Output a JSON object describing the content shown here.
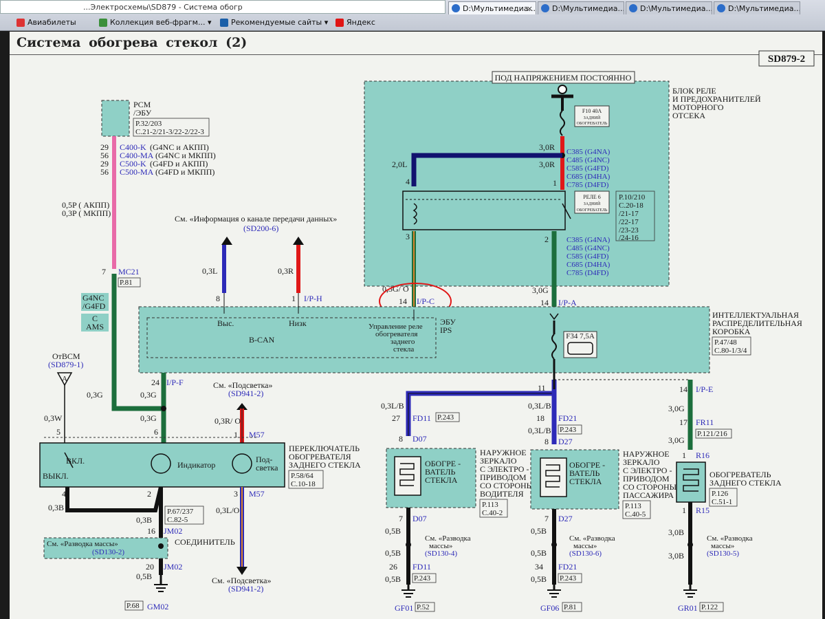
{
  "browser": {
    "address_text": "...Электросхемы\\SD879 - Система обогр",
    "tabs": [
      {
        "label": "D:\\Мультимедиа..."
      },
      {
        "label": "D:\\Мультимедиа..."
      },
      {
        "label": "D:\\Мультимедиа..."
      },
      {
        "label": "D:\\Мультимедиа..."
      }
    ],
    "favorites": [
      {
        "label": "Авиабилеты"
      },
      {
        "label": "Коллекция веб-фрагм..."
      },
      {
        "label": "Рекомендуемые сайты"
      },
      {
        "label": "Яндекс"
      }
    ]
  },
  "page": {
    "title": "Система  обогрева  стекол (2)",
    "code": "SD879-2"
  },
  "top_label": "ПОД НАПРЯЖЕНИЕМ ПОСТОЯННО",
  "relay_block": {
    "title": [
      "БЛОК РЕЛЕ",
      "И ПРЕДОХРАНИТЕЛЕЙ",
      "МОТОРНОГО",
      "ОТСЕКА"
    ],
    "fuse": [
      "F10 40A",
      "ЗАДНИЙ",
      "ОБОГРЕВАТЕЛЬ"
    ],
    "relay": [
      "РЕЛЕ 6",
      "ЗАДНИЙ",
      "ОБОГРЕВАТЕЛЬ"
    ],
    "refs": [
      "P.10/210",
      "C.20-18",
      "/21-17",
      "/22-17",
      "/23-23",
      "/24-16"
    ],
    "conn_top": [
      "C385 (G4NA)",
      "C485 (G4NC)",
      "C585 (G4FD)",
      "C685 (D4HA)",
      "C785 (D4FD)"
    ],
    "conn_bottom": [
      "C385 (G4NA)",
      "C485 (G4NC)",
      "C585 (G4FD)",
      "C685 (D4HA)",
      "C785 (D4FD)"
    ],
    "wire_30r_1": "3,0R",
    "wire_30r_2": "3,0R",
    "wire_20l": "2,0L",
    "pin4": "4",
    "pin1": "1",
    "pin3": "3",
    "pin2": "2"
  },
  "pcm": {
    "label": [
      "PCM",
      "/ЭБУ"
    ],
    "refs": [
      "P.32/203",
      "C.21-2/21-3/22-2/22-3"
    ],
    "conns": [
      {
        "pin": "29",
        "code": "C400-K",
        "desc": "(G4NC и АКПП)"
      },
      {
        "pin": "56",
        "code": "C400-MA",
        "desc": "(G4NC и МКПП)"
      },
      {
        "pin": "29",
        "code": "C500-K",
        "desc": "(G4FD и АКПП)"
      },
      {
        "pin": "56",
        "code": "C500-MA",
        "desc": "(G4FD и МКПП)"
      }
    ],
    "wire": [
      "0,5P ( АКПП)",
      "0,3P ( МКПП)"
    ],
    "mc21_pin": "7",
    "mc21": "MC21",
    "mc21_ref": "P.81",
    "variants": [
      "G4NC",
      "/G4FD",
      "C",
      "AMS"
    ]
  },
  "can": {
    "see_text": "См. «Информация  о канале  передачи  данных»",
    "see_ref": "(SD200-6)",
    "wire_l": "0,3L",
    "wire_r": "0,3R",
    "pin8": "8",
    "pin1": "1",
    "iph": "I/P-H",
    "high": "Выс.",
    "low": "Низк",
    "bus": "B-CAN"
  },
  "ecu": {
    "label": [
      "ЭБУ",
      "IPS"
    ],
    "control": [
      "Управление реле",
      "обогревателя",
      "заднего",
      "стекла"
    ],
    "wire_03g": "0,3G/ O",
    "wire_30g": "3,0G",
    "pin14a": "14",
    "pin14b": "14",
    "ipc": "I/P-C",
    "ipa": "I/P-A",
    "fuse": "F34 7,5A"
  },
  "ipb": {
    "title": [
      "ИНТЕЛЛЕКТУАЛЬНАЯ",
      "РАСПРЕДЕЛИТЕЛЬНАЯ",
      "КОРОБКА"
    ],
    "refs": [
      "P.47/48",
      "C.80-1/3/4"
    ]
  },
  "bcm": {
    "label": "ОтBCM",
    "ref": "(SD879-1)",
    "letter": "A",
    "wire": "0,3W",
    "pin": "5"
  },
  "switch": {
    "pin24": "24",
    "ipf": "I/P-F",
    "wire_03g_a": "0,3G",
    "wire_03g_b": "0,3G",
    "wire_03g_c": "0,3G",
    "pin6": "6",
    "on": "ВКЛ.",
    "off": "ВЫКЛ.",
    "indicator": "Индикатор",
    "backlight": [
      "Под-",
      "светка"
    ],
    "title": [
      "ПЕРЕКЛЮЧАТЕЛЬ",
      "ОБОГРЕВАТЕЛЯ",
      "ЗАДНЕГО СТЕКЛА"
    ],
    "refs": [
      "P.58/64",
      "C.10-18"
    ],
    "pin4": "4",
    "pin2": "2",
    "pin3": "3",
    "m57b": "M57",
    "wire_03b_a": "0,3B",
    "wire_03b_b": "0,3B",
    "wire_03lo": "0,3L/O"
  },
  "backlight_top": {
    "see": "См. «Подсветка»",
    "ref": "(SD941-2)",
    "wire": "0,3R/ O",
    "pin": "1",
    "conn": "M57"
  },
  "backlight_bottom": {
    "see": "См. «Подсветка»",
    "ref": "(SD941-2)"
  },
  "jm02": {
    "pin16": "16",
    "conn16": "JM02",
    "refs": [
      "P.67/237",
      "C.82-5"
    ],
    "joint": "СОЕДИНИТЕЛЬ",
    "ground_see": "См. «Разводка   массы»",
    "ground_ref": "(SD130-2)",
    "pin20": "20",
    "conn20": "JM02",
    "wire05": "0,5B",
    "ground": "GM02",
    "ground_ref_box": "P.68"
  },
  "mirror_driver": {
    "wire1": "0,3L/B",
    "pin27": "27",
    "fd11": "FD11",
    "ref1": "P.243",
    "pin8": "8",
    "d07": "D07",
    "heater": [
      "ОБОГРЕ -",
      "ВАТЕЛЬ",
      "СТЕКЛА"
    ],
    "title": [
      "НАРУЖНОЕ",
      "ЗЕРКАЛО",
      "С ЭЛЕКТРО -",
      "ПРИВОДОМ",
      "СО СТОРОНЫ",
      "ВОДИТЕЛЯ"
    ],
    "refs": [
      "P.113",
      "C.40-2"
    ],
    "pin7": "7",
    "d07b": "D07",
    "wire05a": "0,5B",
    "wire05b": "0,5B",
    "wire05c": "0,5B",
    "ground_see": [
      "См. «Разводка",
      "массы»"
    ],
    "ground_ref": "(SD130-4)",
    "pin26": "26",
    "fd11b": "FD11",
    "ref2": "P.243",
    "ground": "GF01",
    "ground_ref_box": "P.52"
  },
  "mirror_pass": {
    "wire1": "0,3L/B",
    "wire2": "0,3L/B",
    "pin11": "11",
    "pin18": "18",
    "fd21": "FD21",
    "ref1": "P.243",
    "pin8": "8",
    "d27": "D27",
    "heater": [
      "ОБОГРЕ -",
      "ВАТЕЛЬ",
      "СТЕКЛА"
    ],
    "title": [
      "НАРУЖНОЕ",
      "ЗЕРКАЛО",
      "С ЭЛЕКТРО -",
      "ПРИВОДОМ",
      "СО СТОРОНЫ",
      "ПАССАЖИРА"
    ],
    "refs": [
      "P.113",
      "C.40-5"
    ],
    "pin7": "7",
    "d27b": "D27",
    "wire05a": "0,5B",
    "wire05b": "0,5B",
    "wire05c": "0,5B",
    "ground_see": [
      "См. «Разводка",
      "массы»"
    ],
    "ground_ref": "(SD130-6)",
    "pin34": "34",
    "fd21b": "FD21",
    "ref2": "P.243",
    "ground": "GF06",
    "ground_ref_box": "P.81"
  },
  "rear_heater": {
    "pin14": "14",
    "ipe": "I/P-E",
    "wire1": "3,0G",
    "pin17": "17",
    "fr11": "FR11",
    "ref1": "P.121/216",
    "wire2": "3,0G",
    "pin1": "1",
    "r16": "R16",
    "title": [
      "ОБОГРЕВАТЕЛЬ",
      "ЗАДНЕГО СТЕКЛА"
    ],
    "refs": [
      "P.126",
      "C.51-1"
    ],
    "pin1b": "1",
    "r15": "R15",
    "wire3": "3,0B",
    "wire4": "3,0B",
    "ground_see": [
      "См. «Разводка",
      "массы»"
    ],
    "ground_ref": "(SD130-5)",
    "ground": "GR01",
    "ground_ref_box": "P.122"
  }
}
